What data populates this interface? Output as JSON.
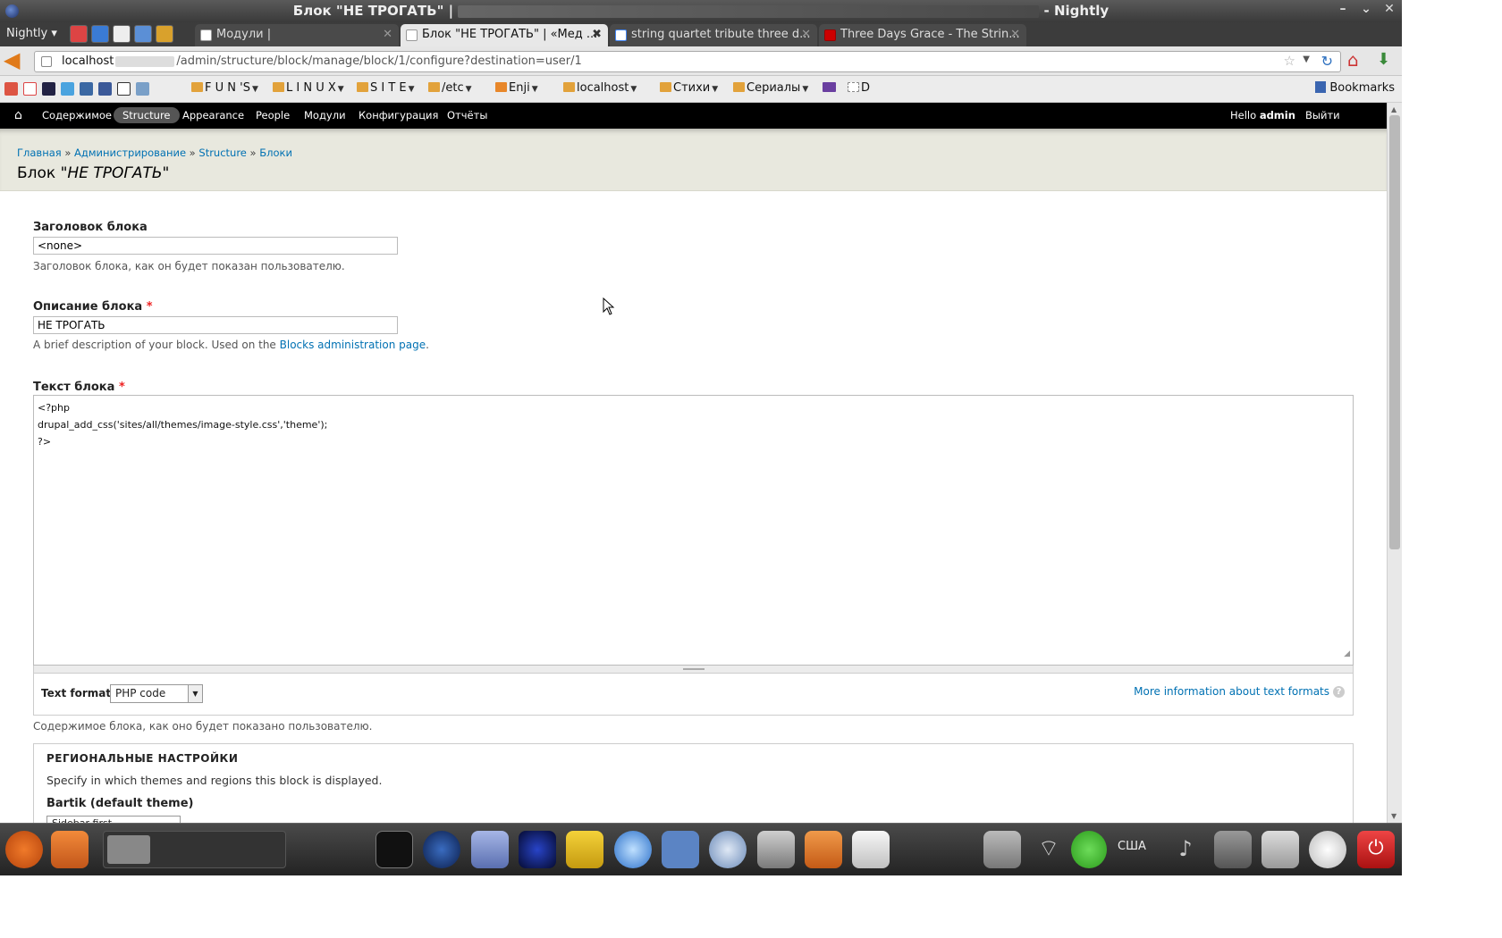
{
  "window": {
    "title": "Блок \"НЕ ТРОГАТЬ\" | ",
    "title_suffix": " - Nightly"
  },
  "browser": {
    "app_menu": "Nightly",
    "tabs": [
      {
        "label": "Модули |",
        "active": false
      },
      {
        "label": "Блок \"НЕ ТРОГАТЬ\" | «Мед ...",
        "active": true
      },
      {
        "label": "string quartet tribute three d...",
        "active": false
      },
      {
        "label": "Three Days Grace - The Strin...",
        "active": false
      }
    ],
    "url_host": "localhost",
    "url_path": "/admin/structure/block/manage/block/1/configure?destination=user/1",
    "bookmarks": [
      {
        "label": "F U N 'S"
      },
      {
        "label": "L I N U X"
      },
      {
        "label": "S I T E"
      },
      {
        "label": "/etc"
      },
      {
        "label": "Enji"
      },
      {
        "label": "localhost"
      },
      {
        "label": "Стихи"
      },
      {
        "label": "Сериалы"
      },
      {
        "label": "D"
      }
    ],
    "bookmarks_menu": "Bookmarks"
  },
  "toolbar": {
    "items": [
      "Содержимое",
      "Structure",
      "Appearance",
      "People",
      "Модули",
      "Конфигурация",
      "Отчёты"
    ],
    "active_item": "Structure",
    "hello_prefix": "Hello ",
    "user": "admin",
    "logout": "Выйти"
  },
  "page": {
    "breadcrumb": [
      "Главная",
      "Администрирование",
      "Structure",
      "Блоки"
    ],
    "breadcrumb_sep": " » ",
    "title_prefix": "Блок \"",
    "title_em": "НЕ ТРОГАТЬ",
    "title_suffix": "\""
  },
  "form": {
    "block_title_label": "Заголовок блока",
    "block_title_value": "<none>",
    "block_title_desc": "Заголовок блока, как он будет показан пользователю.",
    "block_desc_label": "Описание блока",
    "block_desc_value": "НЕ ТРОГАТЬ",
    "block_desc_desc_prefix": "A brief description of your block. Used on the ",
    "block_desc_link": "Blocks administration page",
    "block_desc_desc_suffix": ".",
    "body_label": "Текст блока",
    "required_mark": "*",
    "body_value": "<?php\ndrupal_add_css('sites/all/themes/image-style.css','theme');\n?>",
    "text_format_label": "Text format",
    "text_format_value": "PHP code",
    "text_format_more": "More information about text formats",
    "help_glyph": "?",
    "body_desc": "Содержимое блока, как оно будет показано пользователю.",
    "regions_title": "РЕГИОНАЛЬНЫЕ НАСТРОЙКИ",
    "regions_desc": "Specify in which themes and regions this block is displayed.",
    "theme_label": "Bartik (default theme)",
    "theme_region_value": "Sidebar first"
  },
  "dock": {
    "keyboard_layout": "США"
  }
}
